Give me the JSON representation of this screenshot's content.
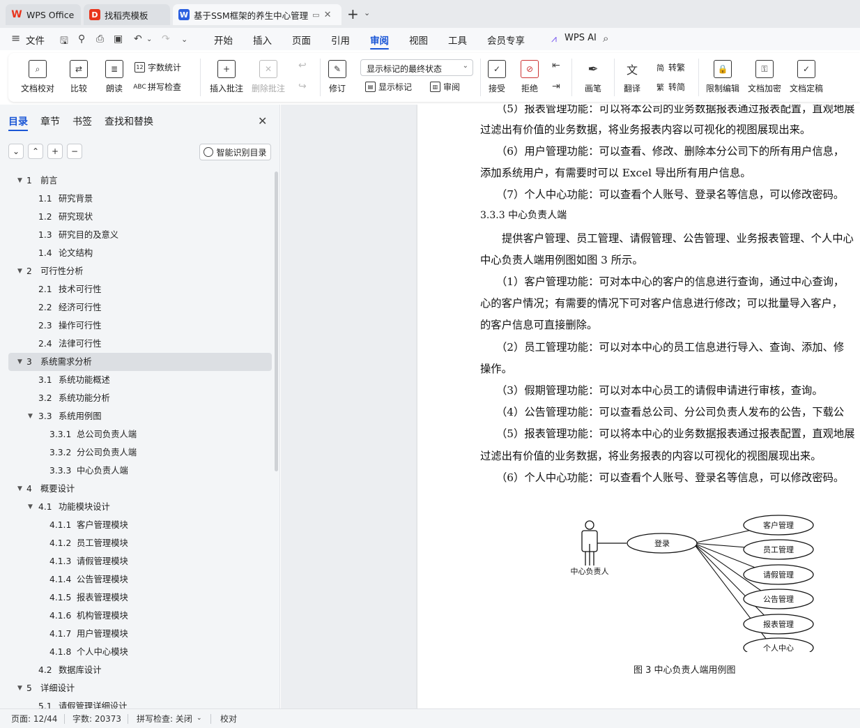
{
  "tabs": [
    {
      "label": "WPS Office",
      "icon": "wps-logo-icon",
      "color": "#e8341c"
    },
    {
      "label": "找稻壳模板",
      "icon": "docer-icon",
      "color": "#e8341c"
    },
    {
      "label": "基于SSM框架的养生中心管理",
      "icon": "writer-icon",
      "color": "#2b5fe0",
      "active": true
    }
  ],
  "menu": {
    "file": "文件",
    "items": [
      "开始",
      "插入",
      "页面",
      "引用",
      "审阅",
      "视图",
      "工具",
      "会员专享"
    ],
    "active": "审阅",
    "wps_ai": "WPS AI"
  },
  "ribbon": {
    "doc_check": "文档校对",
    "compare": "比较",
    "read_aloud": "朗读",
    "word_count": "字数统计",
    "spell_check": "拼写检查",
    "insert_comment": "插入批注",
    "delete_comment": "删除批注",
    "revise": "修订",
    "markup_view": "显示标记的最终状态",
    "show_markup": "显示标记",
    "review": "审阅",
    "accept": "接受",
    "reject": "拒绝",
    "pen": "画笔",
    "translate": "翻译",
    "to_traditional": "转繁",
    "to_simplified": "转简",
    "restrict_edit": "限制编辑",
    "encrypt": "文档加密",
    "finalize": "文档定稿"
  },
  "nav": {
    "tabs": [
      "目录",
      "章节",
      "书签",
      "查找和替换"
    ],
    "active_tab": "目录",
    "smart_toc": "智能识别目录",
    "toc": [
      {
        "num": "1",
        "text": "前言",
        "level": 1,
        "expanded": true
      },
      {
        "num": "1.1",
        "text": "研究背景",
        "level": 2
      },
      {
        "num": "1.2",
        "text": "研究现状",
        "level": 2
      },
      {
        "num": "1.3",
        "text": "研究目的及意义",
        "level": 2
      },
      {
        "num": "1.4",
        "text": "论文结构",
        "level": 2
      },
      {
        "num": "2",
        "text": "可行性分析",
        "level": 1,
        "expanded": true
      },
      {
        "num": "2.1",
        "text": "技术可行性",
        "level": 2
      },
      {
        "num": "2.2",
        "text": "经济可行性",
        "level": 2
      },
      {
        "num": "2.3",
        "text": "操作可行性",
        "level": 2
      },
      {
        "num": "2.4",
        "text": "法律可行性",
        "level": 2
      },
      {
        "num": "3",
        "text": "系统需求分析",
        "level": 1,
        "expanded": true,
        "selected": true
      },
      {
        "num": "3.1",
        "text": "系统功能概述",
        "level": 2
      },
      {
        "num": "3.2",
        "text": "系统功能分析",
        "level": 2
      },
      {
        "num": "3.3",
        "text": "系统用例图",
        "level": 2,
        "expanded": true
      },
      {
        "num": "3.3.1",
        "text": "总公司负责人端",
        "level": 3
      },
      {
        "num": "3.3.2",
        "text": "分公司负责人端",
        "level": 3
      },
      {
        "num": "3.3.3",
        "text": "中心负责人端",
        "level": 3
      },
      {
        "num": "4",
        "text": "概要设计",
        "level": 1,
        "expanded": true
      },
      {
        "num": "4.1",
        "text": "功能模块设计",
        "level": 2,
        "expanded": true
      },
      {
        "num": "4.1.1",
        "text": "客户管理模块",
        "level": 3
      },
      {
        "num": "4.1.2",
        "text": "员工管理模块",
        "level": 3
      },
      {
        "num": "4.1.3",
        "text": "请假管理模块",
        "level": 3
      },
      {
        "num": "4.1.4",
        "text": "公告管理模块",
        "level": 3
      },
      {
        "num": "4.1.5",
        "text": "报表管理模块",
        "level": 3
      },
      {
        "num": "4.1.6",
        "text": "机构管理模块",
        "level": 3
      },
      {
        "num": "4.1.7",
        "text": "用户管理模块",
        "level": 3
      },
      {
        "num": "4.1.8",
        "text": "个人中心模块",
        "level": 3
      },
      {
        "num": "4.2",
        "text": "数据库设计",
        "level": 2
      },
      {
        "num": "5",
        "text": "详细设计",
        "level": 1,
        "expanded": true
      },
      {
        "num": "5.1",
        "text": "请假管理详细设计",
        "level": 2
      }
    ]
  },
  "document": {
    "lines": [
      "（5）报表管理功能：可以将本公司的业务数据报表通过报表配置，直观地展",
      "过滤出有价值的业务数据，将业务报表内容以可视化的视图展现出来。",
      "（6）用户管理功能：可以查看、修改、删除本分公司下的所有用户信息，",
      "添加系统用户，有需要时可以 Excel 导出所有用户信息。",
      "（7）个人中心功能：可以查看个人账号、登录名等信息，可以修改密码。",
      "3.3.3   中心负责人端",
      "提供客户管理、员工管理、请假管理、公告管理、业务报表管理、个人中心",
      "中心负责人端用例图如图 3 所示。",
      "（1）客户管理功能：可对本中心的客户的信息进行查询，通过中心查询，",
      "心的客户情况；有需要的情况下可对客户信息进行修改；可以批量导入客户，",
      "的客户信息可直接删除。",
      "（2）员工管理功能：可以对本中心的员工信息进行导入、查询、添加、修",
      "操作。",
      "（3）假期管理功能：可以对本中心员工的请假申请进行审核，查询。",
      "（4）公告管理功能：可以查看总公司、分公司负责人发布的公告，下载公",
      "（5）报表管理功能：可以将本中心的业务数据报表通过报表配置，直观地展",
      "过滤出有价值的业务数据，将业务报表的内容以可视化的视图展现出来。",
      "（6）个人中心功能：可以查看个人账号、登录名等信息，可以修改密码。"
    ],
    "diagram": {
      "actor": "中心负责人",
      "hub": "登录",
      "use_cases": [
        "客户管理",
        "员工管理",
        "请假管理",
        "公告管理",
        "报表管理",
        "个人中心"
      ]
    },
    "caption": "图 3    中心负责人端用例图"
  },
  "status": {
    "page": "页面: 12/44",
    "words": "字数: 20373",
    "spell": "拼写检查: 关闭",
    "proofread": "校对"
  }
}
